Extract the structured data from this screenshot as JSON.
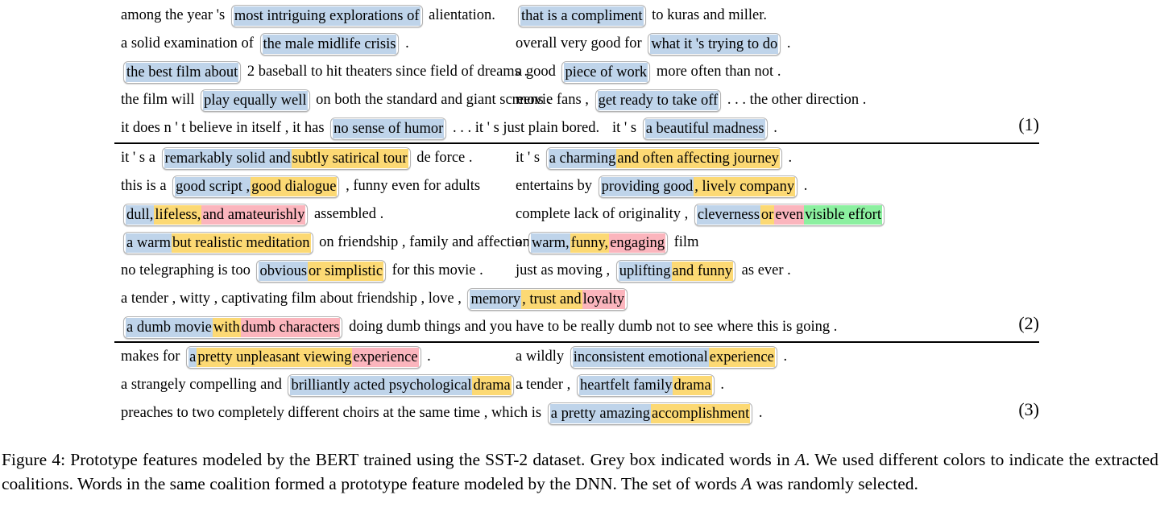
{
  "figure": {
    "caption_prefix": "Figure 4:",
    "caption": "Figure 4: Prototype features modeled by the BERT trained using the SST-2 dataset. Grey box indicated words in A. We used different colors to indicate the extracted coalitions. Words in the same coalition formed a prototype feature modeled by the DNN. The set of words A was randomly selected.",
    "caption_part1": "Figure 4: Prototype features modeled by the BERT trained using the SST-2 dataset. Grey box indicated words in ",
    "caption_italic1": "A",
    "caption_part2": ". We used different colors to indicate the extracted coalitions. Words in the same coalition formed a prototype feature modeled by the DNN. The set of words ",
    "caption_italic2": "A",
    "caption_part3": " was randomly selected."
  },
  "colors": {
    "blue": "#bfd4ea",
    "yellow": "#fcd974",
    "pink": "#fbb5bd",
    "green": "#8cf0a0",
    "box_border": "#b3b3b3",
    "rule": "#000000"
  },
  "blocks": [
    {
      "number": "(1)",
      "rows": [
        {
          "left": {
            "pre": "among the year 's",
            "box": [
              {
                "text": "most intriguing explorations of",
                "color": "blue"
              }
            ],
            "post": "alientation."
          },
          "right": {
            "offset": 640,
            "pre": "",
            "box": [
              {
                "text": "that is a compliment",
                "color": "blue"
              }
            ],
            "post": "to kuras and miller."
          }
        },
        {
          "left": {
            "pre": "a solid examination of",
            "box": [
              {
                "text": "the male midlife crisis",
                "color": "blue"
              }
            ],
            "post": "."
          },
          "right": {
            "offset": 640,
            "pre": "overall very good for",
            "box": [
              {
                "text": "what it 's trying to do",
                "color": "blue"
              }
            ],
            "post": "."
          }
        },
        {
          "left": {
            "pre": "",
            "box": [
              {
                "text": "the best film about",
                "color": "blue"
              }
            ],
            "post": "2 baseball to hit theaters since field of dreams ."
          },
          "right": {
            "offset": 640,
            "pre": "a good",
            "box": [
              {
                "text": "piece of work",
                "color": "blue"
              }
            ],
            "post": "more often than not ."
          }
        },
        {
          "left": {
            "pre": "the film will",
            "box": [
              {
                "text": "play equally well",
                "color": "blue"
              }
            ],
            "post": "on both the standard and giant screens ."
          },
          "right": {
            "offset": 640,
            "pre": "movie fans ,",
            "box": [
              {
                "text": "get ready to take off",
                "color": "blue"
              }
            ],
            "post": ". . . the other direction ."
          }
        },
        {
          "left": {
            "pre": "it does n ' t believe in itself , it has",
            "box": [
              {
                "text": "no sense of humor",
                "color": "blue"
              }
            ],
            "post": ". . . it ' s just plain bored."
          },
          "right": {
            "offset": 760,
            "pre": "it ' s",
            "box": [
              {
                "text": "a beautiful madness",
                "color": "blue"
              }
            ],
            "post": "."
          }
        }
      ]
    },
    {
      "number": "(2)",
      "rows": [
        {
          "left": {
            "pre": "it ' s a",
            "box": [
              {
                "text": "remarkably solid and",
                "color": "blue"
              },
              {
                "text": "subtly satirical tour",
                "color": "yellow"
              }
            ],
            "post": "de force ."
          },
          "right": {
            "offset": 640,
            "pre": "it ' s",
            "box": [
              {
                "text": "a charming",
                "color": "blue"
              },
              {
                "text": "and often affecting journey",
                "color": "yellow"
              }
            ],
            "post": "."
          }
        },
        {
          "left": {
            "pre": "this is a",
            "box": [
              {
                "text": "good script ,",
                "color": "blue"
              },
              {
                "text": "good dialogue",
                "color": "yellow"
              }
            ],
            "post": ", funny even for adults"
          },
          "right": {
            "offset": 640,
            "pre": "entertains by",
            "box": [
              {
                "text": "providing good",
                "color": "blue"
              },
              {
                "text": ", lively company",
                "color": "yellow"
              }
            ],
            "post": "."
          }
        },
        {
          "left": {
            "pre": "",
            "box": [
              {
                "text": "dull,",
                "color": "blue"
              },
              {
                "text": "lifeless,",
                "color": "yellow"
              },
              {
                "text": "and amateurishly",
                "color": "pink"
              }
            ],
            "post": "assembled ."
          },
          "right": {
            "offset": 640,
            "pre": "complete lack of originality ,",
            "box": [
              {
                "text": "cleverness",
                "color": "blue"
              },
              {
                "text": "or",
                "color": "yellow"
              },
              {
                "text": "even",
                "color": "pink"
              },
              {
                "text": "visible effort",
                "color": "green"
              }
            ],
            "post": ""
          }
        },
        {
          "left": {
            "pre": "",
            "box": [
              {
                "text": "a warm",
                "color": "blue"
              },
              {
                "text": "but realistic meditation",
                "color": "yellow"
              }
            ],
            "post": "on friendship , family and affection ."
          },
          "right": {
            "offset": 640,
            "pre": "a",
            "box": [
              {
                "text": "warm,",
                "color": "blue"
              },
              {
                "text": "funny,",
                "color": "yellow"
              },
              {
                "text": "engaging",
                "color": "pink"
              }
            ],
            "post": "film"
          }
        },
        {
          "left": {
            "pre": "no telegraphing is too",
            "box": [
              {
                "text": "obvious",
                "color": "blue"
              },
              {
                "text": "or simplistic",
                "color": "yellow"
              }
            ],
            "post": "for this movie ."
          },
          "right": {
            "offset": 640,
            "pre": "just as moving ,",
            "box": [
              {
                "text": "uplifting",
                "color": "blue"
              },
              {
                "text": "and funny",
                "color": "yellow"
              }
            ],
            "post": "as ever ."
          }
        },
        {
          "left": {
            "pre": "a tender , witty , captivating film about friendship , love ,",
            "box": [
              {
                "text": "memory",
                "color": "blue"
              },
              {
                "text": ", trust and",
                "color": "yellow"
              },
              {
                "text": "loyalty",
                "color": "pink"
              }
            ],
            "post": ""
          },
          "right": null
        },
        {
          "left": {
            "pre": "",
            "box": [
              {
                "text": "a dumb movie",
                "color": "blue"
              },
              {
                "text": "with",
                "color": "yellow"
              },
              {
                "text": "dumb characters",
                "color": "pink"
              }
            ],
            "post": "doing dumb things and you have to be really dumb not to see where this is going ."
          },
          "right": null
        }
      ]
    },
    {
      "number": "(3)",
      "rows": [
        {
          "left": {
            "pre": "makes for",
            "box": [
              {
                "text": "a",
                "color": "blue"
              },
              {
                "text": "pretty unpleasant viewing",
                "color": "yellow"
              },
              {
                "text": "experience",
                "color": "pink"
              }
            ],
            "post": "."
          },
          "right": {
            "offset": 640,
            "pre": "a wildly",
            "box": [
              {
                "text": "inconsistent emotional",
                "color": "blue"
              },
              {
                "text": "experience",
                "color": "yellow"
              }
            ],
            "post": "."
          }
        },
        {
          "left": {
            "pre": "a strangely compelling and",
            "box": [
              {
                "text": "brilliantly acted psychological",
                "color": "blue"
              },
              {
                "text": "drama",
                "color": "yellow"
              }
            ],
            "post": "."
          },
          "right": {
            "offset": 640,
            "pre": "a tender ,",
            "box": [
              {
                "text": "heartfelt family",
                "color": "blue"
              },
              {
                "text": "drama",
                "color": "yellow"
              }
            ],
            "post": "."
          }
        },
        {
          "left": {
            "pre": "preaches to two completely different choirs at the same time , which is",
            "box": [
              {
                "text": "a pretty amazing",
                "color": "blue"
              },
              {
                "text": "accomplishment",
                "color": "yellow"
              }
            ],
            "post": "."
          },
          "right": null
        }
      ]
    }
  ]
}
